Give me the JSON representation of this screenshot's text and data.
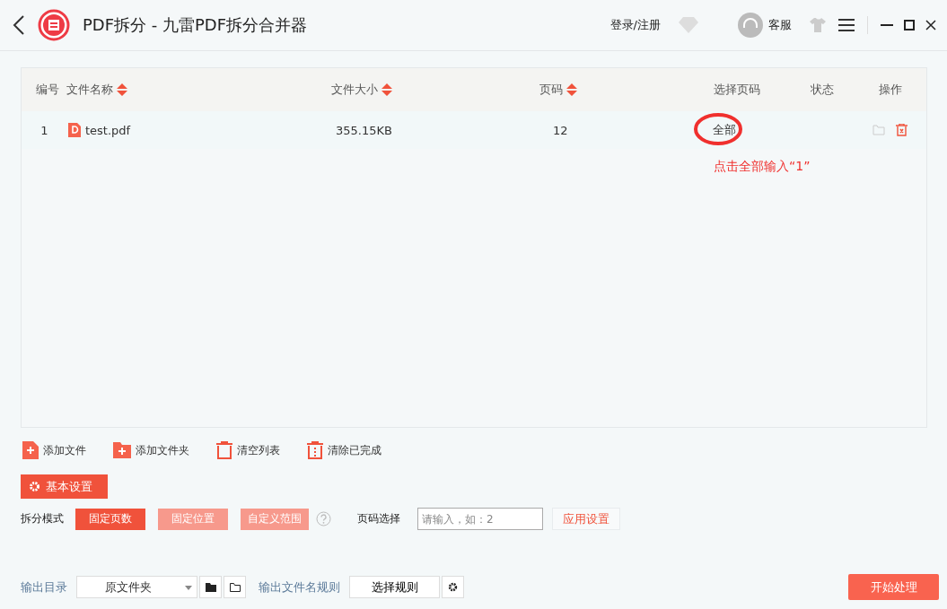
{
  "window": {
    "title": "PDF拆分 - 九雷PDF拆分合并器",
    "login": "登录/注册",
    "service": "客服"
  },
  "table": {
    "columns": [
      {
        "label": "编号",
        "sortable": false
      },
      {
        "label": "文件名称",
        "sortable": true
      },
      {
        "label": "文件大小",
        "sortable": true
      },
      {
        "label": "页码",
        "sortable": true
      },
      {
        "label": "选择页码",
        "sortable": false
      },
      {
        "label": "状态",
        "sortable": false
      },
      {
        "label": "操作",
        "sortable": false
      }
    ],
    "rows": [
      {
        "index": "1",
        "name": "test.pdf",
        "size": "355.15KB",
        "pages": "12",
        "page_select": "全部",
        "status": ""
      }
    ]
  },
  "annotation": {
    "text": "点击全部输入“1”"
  },
  "actions": [
    {
      "kind": "add-file",
      "label": "添加文件"
    },
    {
      "kind": "add-folder",
      "label": "添加文件夹"
    },
    {
      "kind": "clear",
      "label": "清空列表"
    },
    {
      "kind": "remove-done",
      "label": "清除已完成"
    }
  ],
  "settings": {
    "title": "基本设置",
    "mode_label": "拆分模式",
    "modes": [
      {
        "label": "固定页数",
        "selected": true
      },
      {
        "label": "固定位置",
        "selected": false
      },
      {
        "label": "自定义范围",
        "selected": false
      }
    ],
    "page_label": "页码选择",
    "page_placeholder": "请输入，如：2",
    "apply": "应用设置"
  },
  "output": {
    "dir_label": "输出目录",
    "dir_value": "原文件夹",
    "rule_label": "输出文件名规则",
    "rule_button": "选择规则",
    "start": "开始处理"
  }
}
